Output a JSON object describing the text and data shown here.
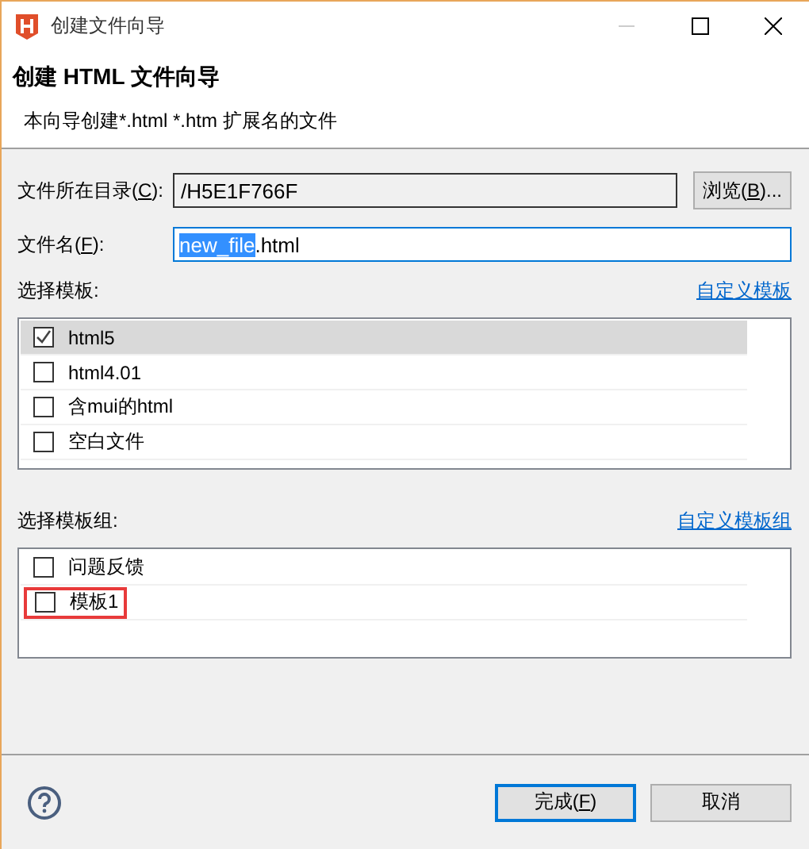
{
  "window": {
    "title": "创建文件向导"
  },
  "header": {
    "title": "创建 HTML 文件向导",
    "description": "本向导创建*.html *.htm 扩展名的文件"
  },
  "directory": {
    "label": "文件所在目录(",
    "mnemonic": "C",
    "suffix": "):",
    "value": "/H5E1F766F",
    "browse": {
      "label": "浏览(",
      "mnemonic": "B",
      "suffix": ")..."
    }
  },
  "filename": {
    "label": "文件名(",
    "mnemonic": "F",
    "suffix": "):",
    "selected_text": "new_file",
    "text": ".html"
  },
  "templates": {
    "label": "选择模板:",
    "link": "自定义模板",
    "items": [
      {
        "label": "html5",
        "checked": true,
        "selected": true,
        "highlighted": false
      },
      {
        "label": "html4.01",
        "checked": false,
        "selected": false,
        "highlighted": false
      },
      {
        "label": "含mui的html",
        "checked": false,
        "selected": false,
        "highlighted": false
      },
      {
        "label": "空白文件",
        "checked": false,
        "selected": false,
        "highlighted": false
      }
    ]
  },
  "template_groups": {
    "label": "选择模板组:",
    "link": "自定义模板组",
    "items": [
      {
        "label": "问题反馈",
        "checked": false,
        "selected": false,
        "highlighted": false
      },
      {
        "label": "模板1",
        "checked": false,
        "selected": false,
        "highlighted": true
      }
    ]
  },
  "buttons": [
    {
      "label": "完成(",
      "mnemonic": "F",
      "suffix": ")",
      "default": true
    },
    {
      "label": "取消",
      "default": false
    }
  ]
}
